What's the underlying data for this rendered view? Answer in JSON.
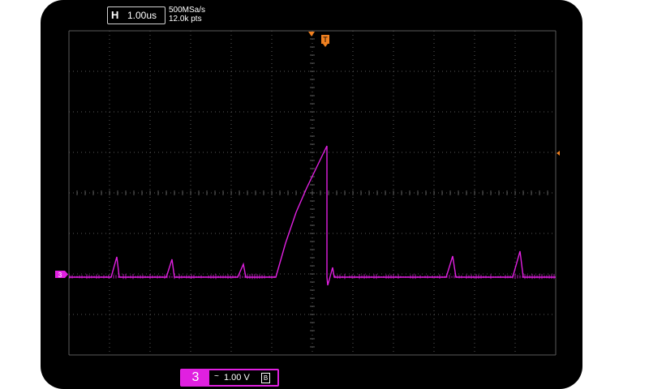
{
  "timebase": {
    "label": "H",
    "value": "1.00us"
  },
  "acquisition": {
    "sample_rate": "500MSa/s",
    "points": "12.0k pts"
  },
  "trigger": {
    "marker": "T"
  },
  "channel": {
    "number": "3",
    "coupling": "~",
    "scale": "1.00 V",
    "bw_label": "B",
    "ground_marker": "3",
    "color": "#e020e0"
  },
  "colors": {
    "trigger": "#f08020",
    "grid": "#5a5a5a",
    "background": "#000000"
  }
}
